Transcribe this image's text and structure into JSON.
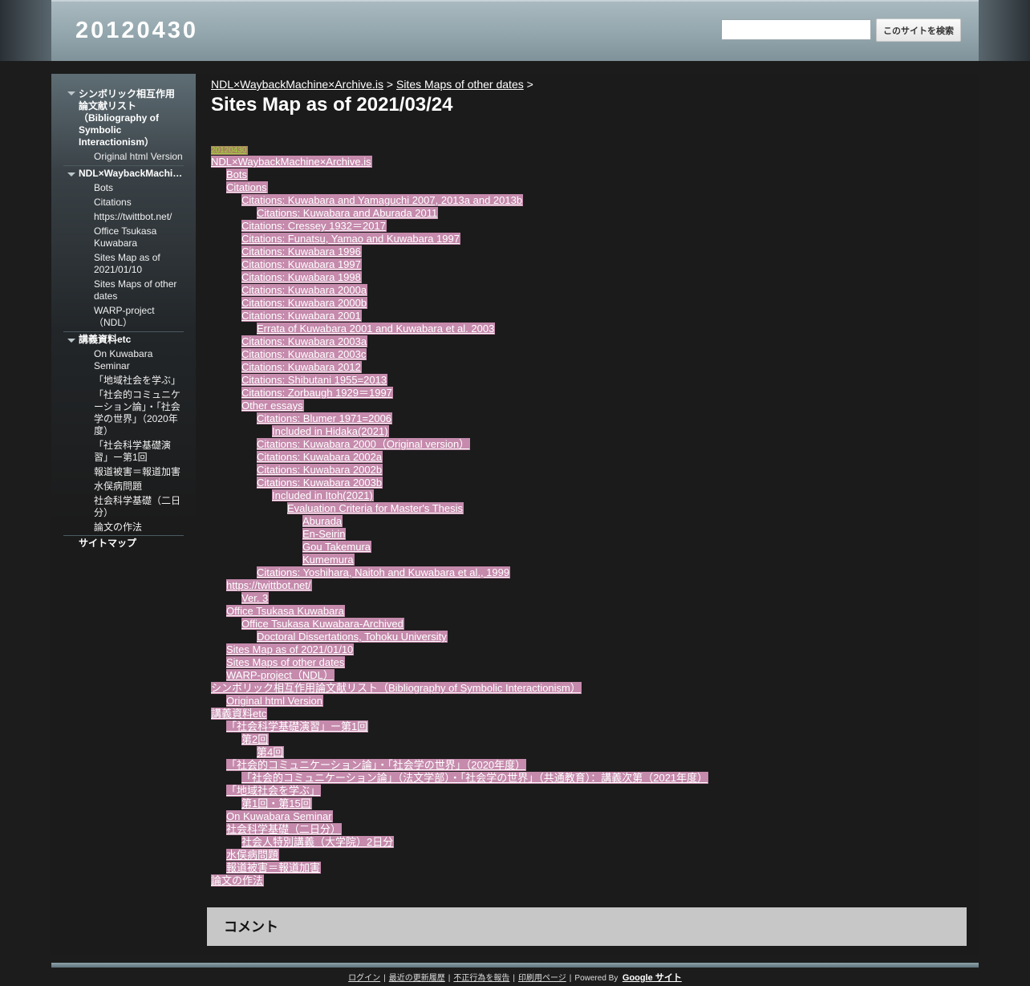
{
  "site": {
    "title": "20120430"
  },
  "search": {
    "placeholder": "",
    "value": "",
    "button_label": "このサイトを検索"
  },
  "sidebar": {
    "groups": [
      {
        "label": "シンボリック相互作用論文献リスト（Bibliography of Symbolic Interactionism）",
        "items": [
          "Original html Version"
        ]
      },
      {
        "label": "NDL×WaybackMachine×Archive.is",
        "items": [
          "Bots",
          "Citations",
          "https://twittbot.net/",
          "Office Tsukasa Kuwabara",
          "Sites Map as of 2021/01/10",
          "Sites Maps of other dates",
          "WARP-project（NDL）"
        ]
      },
      {
        "label": "講義資料etc",
        "items": [
          "On Kuwabara Seminar",
          "「地域社会を学ぶ」",
          "「社会的コミュニケーション論」・「社会学の世界」（2020年度）",
          "「社会科学基礎演習」ー第1回",
          "報道被害＝報道加害",
          "水俣病問題",
          "社会科学基礎（二日分）",
          "論文の作法"
        ]
      }
    ],
    "sitemap_label": "サイトマップ"
  },
  "breadcrumb": {
    "items": [
      "NDL×WaybackMachine×Archive.is",
      "Sites Maps of other dates"
    ],
    "separator": ">"
  },
  "page": {
    "title": "Sites Map as of 2021/03/24"
  },
  "sitemap": [
    {
      "label": "20120430",
      "level": 0,
      "current": true
    },
    {
      "label": "NDL×WaybackMachine×Archive.is",
      "level": 0
    },
    {
      "label": "Bots",
      "level": 1
    },
    {
      "label": "Citations",
      "level": 1
    },
    {
      "label": "Citations: Kuwabara and Yamaguchi 2007, 2013a and 2013b",
      "level": 2
    },
    {
      "label": "Citations: Kuwabara and Aburada 2011",
      "level": 3
    },
    {
      "label": "Citations: Cressey 1932＝2017",
      "level": 2
    },
    {
      "label": "Citations: Funatsu, Yamao and Kuwabara 1997",
      "level": 2
    },
    {
      "label": "Citations: Kuwabara 1996",
      "level": 2
    },
    {
      "label": "Citations: Kuwabara 1997",
      "level": 2
    },
    {
      "label": "Citations: Kuwabara 1998",
      "level": 2
    },
    {
      "label": "Citations: Kuwabara 2000a",
      "level": 2
    },
    {
      "label": "Citations: Kuwabara 2000b",
      "level": 2
    },
    {
      "label": "Citations: Kuwabara 2001",
      "level": 2
    },
    {
      "label": "Errata of Kuwabara 2001 and Kuwabara et al. 2003",
      "level": 3
    },
    {
      "label": "Citations: Kuwabara 2003a",
      "level": 2
    },
    {
      "label": "Citations: Kuwabara 2003c",
      "level": 2
    },
    {
      "label": "Citations: Kuwabara 2012",
      "level": 2
    },
    {
      "label": "Citations: Shibutani 1955=2013",
      "level": 2
    },
    {
      "label": "Citations: Zorbaugh 1929＝1997",
      "level": 2
    },
    {
      "label": "Other essays",
      "level": 2
    },
    {
      "label": "Citations: Blumer 1971=2006",
      "level": 3
    },
    {
      "label": "Included in Hidaka(2021)",
      "level": 4
    },
    {
      "label": "Citations: Kuwabara 2000（Original version）",
      "level": 3
    },
    {
      "label": "Citations: Kuwabara 2002a",
      "level": 3
    },
    {
      "label": "Citations: Kuwabara 2002b",
      "level": 3
    },
    {
      "label": "Citations: Kuwabara 2003b",
      "level": 3
    },
    {
      "label": "Included in Itoh(2021)",
      "level": 4
    },
    {
      "label": "Evaluation Criteria for Master's Thesis",
      "level": 5
    },
    {
      "label": "Aburada",
      "level": 6
    },
    {
      "label": "En-Seirin",
      "level": 6
    },
    {
      "label": "Gou Takemura",
      "level": 6
    },
    {
      "label": "Kumemura",
      "level": 6
    },
    {
      "label": "Citations: Yoshihara, Naitoh and Kuwabara et al., 1999",
      "level": 3
    },
    {
      "label": "https://twittbot.net/",
      "level": 1
    },
    {
      "label": "Ver. 3",
      "level": 2
    },
    {
      "label": "Office Tsukasa Kuwabara",
      "level": 1
    },
    {
      "label": "Office Tsukasa Kuwabara-Archived",
      "level": 2
    },
    {
      "label": "Doctoral Dissertations, Tohoku University",
      "level": 3
    },
    {
      "label": "Sites Map as of 2021/01/10",
      "level": 1
    },
    {
      "label": "Sites Maps of other dates",
      "level": 1
    },
    {
      "label": "WARP-project（NDL）",
      "level": 1
    },
    {
      "label": "シンボリック相互作用論文献リスト（Bibliography of Symbolic Interactionism）",
      "level": 0
    },
    {
      "label": "Original html Version",
      "level": 1
    },
    {
      "label": "講義資料etc",
      "level": 0
    },
    {
      "label": "「社会科学基礎演習」ー第1回",
      "level": 1
    },
    {
      "label": "第2回",
      "level": 2
    },
    {
      "label": "第4回",
      "level": 3
    },
    {
      "label": "「社会的コミュニケーション論」・「社会学の世界」（2020年度）",
      "level": 1
    },
    {
      "label": "「社会的コミュニケーション論」（法文学部）・「社会学の世界」（共通教育）：講義次第（2021年度）",
      "level": 2
    },
    {
      "label": "「地域社会を学ぶ」",
      "level": 1
    },
    {
      "label": "第1回・第15回",
      "level": 2
    },
    {
      "label": "On Kuwabara Seminar",
      "level": 1
    },
    {
      "label": "社会科学基礎（二日分）",
      "level": 1
    },
    {
      "label": "社会人特別講義（大学院）2日分",
      "level": 2
    },
    {
      "label": "水俣病問題",
      "level": 1
    },
    {
      "label": "報道被害＝報道加害",
      "level": 1
    },
    {
      "label": "論文の作法",
      "level": 0
    }
  ],
  "comments": {
    "title": "コメント"
  },
  "footer": {
    "links": [
      "ログイン",
      "最近の更新履歴",
      "不正行為を報告",
      "印刷用ページ"
    ],
    "powered_by": "Powered By",
    "google_sites": "Google サイト"
  },
  "colors": {
    "link_highlight": "#c58aac",
    "current_highlight": "#a7865c",
    "current_text": "#a5ce46"
  }
}
